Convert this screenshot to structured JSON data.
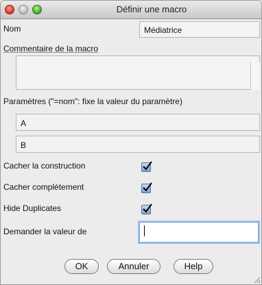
{
  "window": {
    "title": "Définir une macro"
  },
  "form": {
    "name_label": "Nom",
    "name_value": "Médiatrice",
    "comment_label": "Commentaire de la macro",
    "comment_value": "",
    "params_label": "Paramètres (\"=nom\": fixe la valeur du paramètre)",
    "params": [
      "A",
      "B"
    ]
  },
  "options": {
    "hide_construction_label": "Cacher la construction",
    "hide_construction_checked": true,
    "hide_completely_label": "Cacher complètement",
    "hide_completely_checked": true,
    "hide_duplicates_label": "Hide Duplicates",
    "hide_duplicates_checked": true,
    "ask_value_label": "Demander la valeur de",
    "ask_value_value": ""
  },
  "buttons": {
    "ok": "OK",
    "cancel": "Annuler",
    "help": "Help"
  },
  "colors": {
    "checkbox": "#7ba2d8",
    "focus_ring": "#9fc0ea",
    "close": "#d52d1f",
    "zoom": "#3aa21f"
  }
}
